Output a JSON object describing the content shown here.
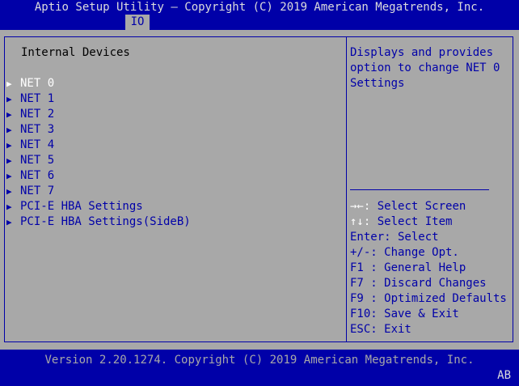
{
  "header": {
    "title": "Aptio Setup Utility – Copyright (C) 2019 American Megatrends, Inc.",
    "active_tab": "IO"
  },
  "main": {
    "section_title": "Internal Devices",
    "items": [
      {
        "label": "NET 0",
        "selected": true
      },
      {
        "label": "NET 1",
        "selected": false
      },
      {
        "label": "NET 2",
        "selected": false
      },
      {
        "label": "NET 3",
        "selected": false
      },
      {
        "label": "NET 4",
        "selected": false
      },
      {
        "label": "NET 5",
        "selected": false
      },
      {
        "label": "NET 6",
        "selected": false
      },
      {
        "label": "NET 7",
        "selected": false
      },
      {
        "label": "PCI-E HBA Settings",
        "selected": false
      },
      {
        "label": "PCI-E HBA Settings(SideB)",
        "selected": false
      }
    ],
    "submenu_glyph": "▶"
  },
  "help": {
    "description": "Displays and provides\noption to change NET 0\nSettings",
    "keys": [
      {
        "key": "→←:",
        "action": " Select Screen"
      },
      {
        "key": "↑↓:",
        "action": " Select Item"
      },
      {
        "key": "Enter:",
        "action": " Select"
      },
      {
        "key": "+/-:",
        "action": " Change Opt."
      },
      {
        "key": "F1 :",
        "action": " General Help"
      },
      {
        "key": "F7 :",
        "action": " Discard Changes"
      },
      {
        "key": "F9 :",
        "action": " Optimized Defaults"
      },
      {
        "key": "F10:",
        "action": " Save & Exit"
      },
      {
        "key": "ESC:",
        "action": " Exit"
      }
    ]
  },
  "footer": {
    "version": "Version 2.20.1274. Copyright (C) 2019 American Megatrends, Inc.",
    "indicator": "AB"
  },
  "colors": {
    "background": "#0000a8",
    "panel": "#a8a8a8",
    "highlight": "#ffffff"
  }
}
